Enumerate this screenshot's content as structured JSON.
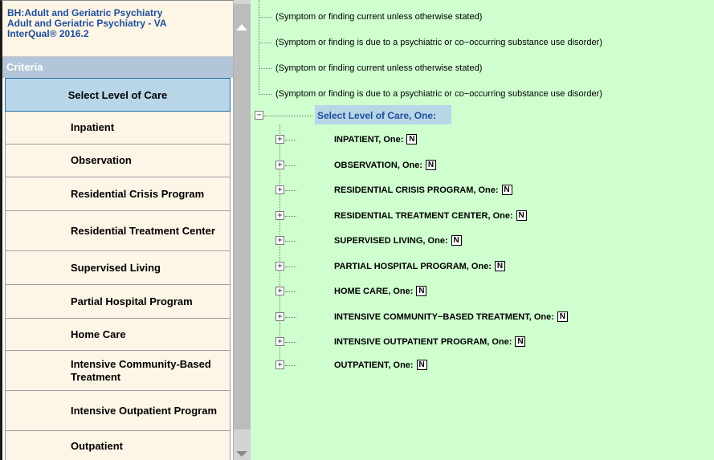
{
  "header": {
    "line1": "BH:Adult and Geriatric Psychiatry",
    "line2": "Adult and Geriatric Psychiatry - VA",
    "line3": "InterQual® 2016.2"
  },
  "criteria_label": "Criteria",
  "nav": {
    "selected": "Select Level of Care",
    "items": [
      {
        "label": "Inpatient"
      },
      {
        "label": "Observation"
      },
      {
        "label": "Residential Crisis Program"
      },
      {
        "label": "Residential Treatment Center"
      },
      {
        "label": "Supervised Living"
      },
      {
        "label": "Partial Hospital Program"
      },
      {
        "label": "Home Care"
      },
      {
        "label": "Intensive Community-Based Treatment"
      },
      {
        "label": "Intensive Outpatient Program"
      },
      {
        "label": "Outpatient"
      }
    ]
  },
  "notes": [
    "(Symptom or finding current unless otherwise stated)",
    "(Symptom or finding is due to a psychiatric or co−occurring substance use disorder)",
    "(Symptom or finding current unless otherwise stated)",
    "(Symptom or finding is due to a psychiatric or co−occurring substance use disorder)"
  ],
  "tree": {
    "root_label": "Select Level of Care, One:",
    "expanded_glyph": "−",
    "collapsed_glyph": "+",
    "note_badge": "N",
    "children": [
      {
        "label": "INPATIENT, One:"
      },
      {
        "label": "OBSERVATION, One:"
      },
      {
        "label": "RESIDENTIAL CRISIS PROGRAM, One:"
      },
      {
        "label": "RESIDENTIAL TREATMENT CENTER, One:"
      },
      {
        "label": "SUPERVISED LIVING, One:"
      },
      {
        "label": "PARTIAL HOSPITAL PROGRAM, One:"
      },
      {
        "label": "HOME CARE, One:"
      },
      {
        "label": "INTENSIVE COMMUNITY−BASED TREATMENT, One:"
      },
      {
        "label": "INTENSIVE OUTPATIENT PROGRAM, One:"
      },
      {
        "label": "OUTPATIENT, One:"
      }
    ]
  },
  "colors": {
    "content_bg": "#cfffcf",
    "header_bg": "#fdf5e6",
    "criteria_bar": "#b3c6d9",
    "selected_bg": "#b8d6e8",
    "title_blue": "#1f4e9c"
  }
}
